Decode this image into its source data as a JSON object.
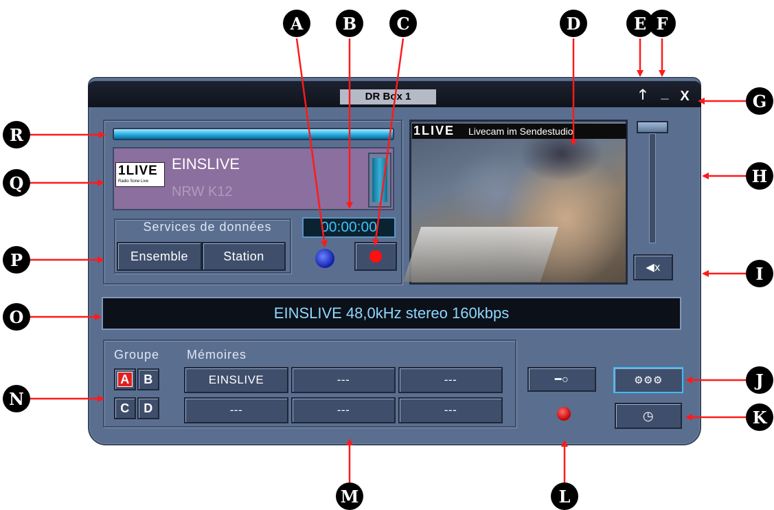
{
  "window": {
    "title": "DR Box 1",
    "up_glyph": "🡑",
    "min_glyph": "_",
    "close_glyph": "X"
  },
  "station": {
    "logo_text": "1LIVE",
    "logo_subtext": "Radio Sone Live",
    "name": "EINSLIVE",
    "subtitle": "NRW K12"
  },
  "services": {
    "label": "Services de données",
    "ensemble": "Ensemble",
    "station": "Station"
  },
  "recorder": {
    "time": "00:00:00"
  },
  "video": {
    "logo": "1LIVE",
    "caption": "Livecam im Sendestudio"
  },
  "volume": {
    "mute_glyph": "◀x"
  },
  "info": {
    "text": "EINSLIVE 48,0kHz stereo 160kbps"
  },
  "presets": {
    "groupe_label": "Groupe",
    "memoires_label": "Mémoires",
    "groups": [
      "A",
      "B",
      "C",
      "D"
    ],
    "active_group": "A",
    "memories": [
      "EINSLIVE",
      "---",
      "---",
      "---",
      "---",
      "---"
    ]
  },
  "controls": {
    "key_glyph": "━○",
    "settings_glyph": "⚙⚙⚙",
    "timer_glyph": "◷"
  },
  "colors": {
    "accent": "#3fbcf0",
    "window": "#5a6e90",
    "record": "#ff1010"
  },
  "callouts": [
    "A",
    "B",
    "C",
    "D",
    "E",
    "F",
    "G",
    "H",
    "I",
    "J",
    "K",
    "L",
    "M",
    "N",
    "O",
    "P",
    "Q",
    "R"
  ]
}
